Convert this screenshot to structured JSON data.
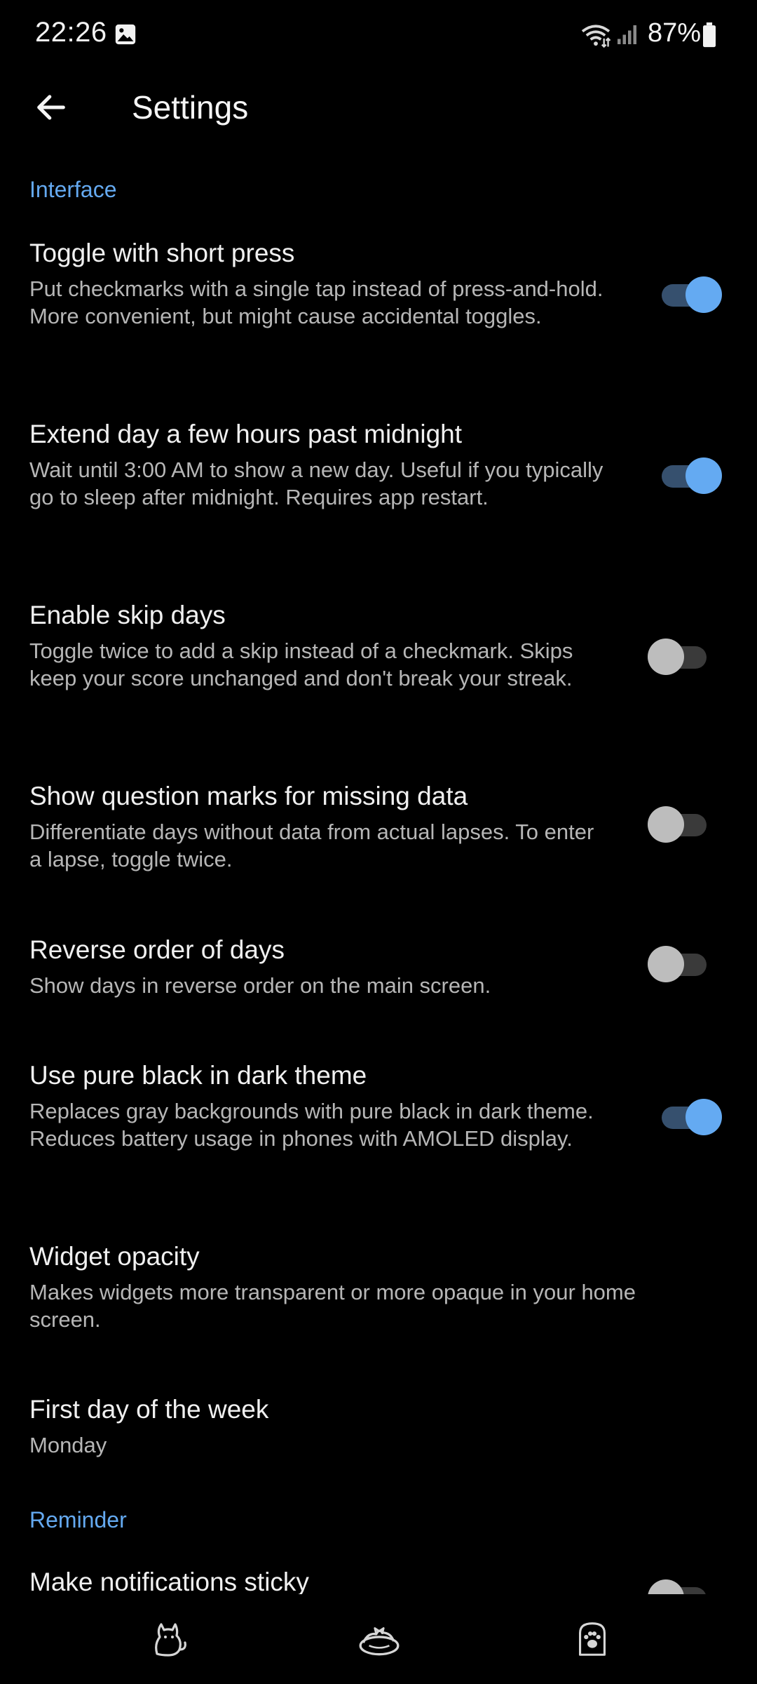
{
  "status_bar": {
    "time": "22:26",
    "battery": "87%",
    "icons": [
      "gallery-icon",
      "wifi-icon",
      "signal-icon",
      "battery-icon"
    ]
  },
  "header": {
    "title": "Settings",
    "back_icon": "arrow-left-icon"
  },
  "sections": {
    "interface": "Interface",
    "reminder": "Reminder"
  },
  "settings": [
    {
      "title": "Toggle with short press",
      "summary": "Put checkmarks with a single tap instead of press-and-hold. More convenient, but might cause accidental toggles.",
      "toggle": true
    },
    {
      "title": "Extend day a few hours past midnight",
      "summary": "Wait until 3:00 AM to show a new day. Useful if you typically go to sleep after midnight. Requires app restart.",
      "toggle": true
    },
    {
      "title": "Enable skip days",
      "summary": "Toggle twice to add a skip instead of a checkmark. Skips keep your score unchanged and don't break your streak.",
      "toggle": false
    },
    {
      "title": "Show question marks for missing data",
      "summary": "Differentiate days without data from actual lapses. To enter a lapse, toggle twice.",
      "toggle": false
    },
    {
      "title": "Reverse order of days",
      "summary": "Show days in reverse order on the main screen.",
      "toggle": false
    },
    {
      "title": "Use pure black in dark theme",
      "summary": "Replaces gray backgrounds with pure black in dark theme. Reduces battery usage in phones with AMOLED display.",
      "toggle": true
    },
    {
      "title": "Widget opacity",
      "summary": "Makes widgets more transparent or more opaque in your home screen."
    },
    {
      "title": "First day of the week",
      "summary": "Monday"
    },
    {
      "title": "Make notifications sticky",
      "toggle": false
    }
  ],
  "bottom_nav": {
    "items": [
      "cat-icon",
      "cat-bed-icon",
      "paw-icon"
    ]
  },
  "colors": {
    "background": "#000000",
    "accent": "#64aaf2",
    "section_header": "#64a9f0",
    "switch_track_on": "#36506e",
    "switch_off_thumb": "#bdbdbd"
  }
}
